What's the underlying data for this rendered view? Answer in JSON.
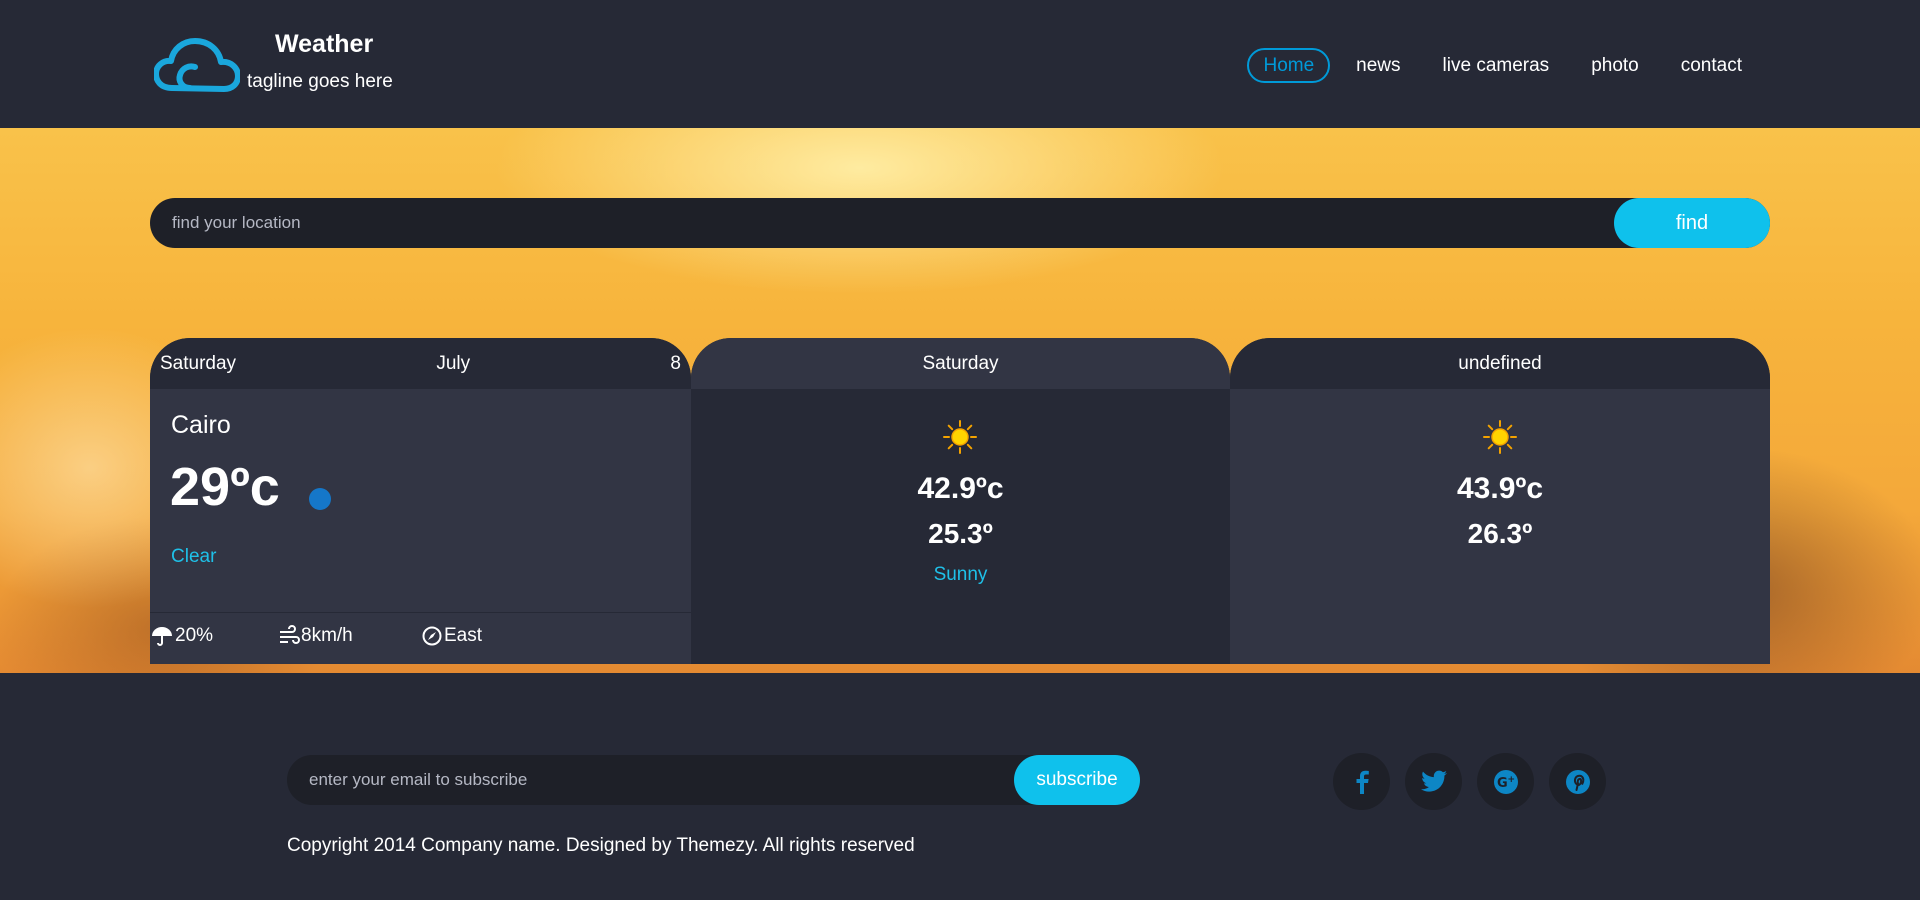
{
  "brand": {
    "title": "Weather",
    "tagline": "tagline goes here"
  },
  "nav": {
    "items": [
      {
        "label": "Home",
        "active": true
      },
      {
        "label": "news",
        "active": false
      },
      {
        "label": "live cameras",
        "active": false
      },
      {
        "label": "photo",
        "active": false
      },
      {
        "label": "contact",
        "active": false
      }
    ]
  },
  "search": {
    "placeholder": "find your location",
    "button_label": "find"
  },
  "today": {
    "day": "Saturday",
    "month": "July",
    "date": "8",
    "city": "Cairo",
    "temperature": "29ºc",
    "condition": "Clear",
    "condition_icon": "moon-icon",
    "stats": {
      "rain": "20%",
      "wind": "8km/h",
      "direction": "East"
    }
  },
  "forecast": [
    {
      "day": "Saturday",
      "max": "42.9ºc",
      "min": "25.3º",
      "condition": "Sunny",
      "icon": "sun-icon"
    },
    {
      "day": "undefined",
      "max": "43.9ºc",
      "min": "26.3º",
      "condition": "",
      "icon": "sun-icon"
    }
  ],
  "footer": {
    "subscribe_placeholder": "enter your email to subscribe",
    "subscribe_button": "subscribe",
    "copyright": "Copyright 2014 Company name. Designed by Themezy. All rights reserved",
    "socials": [
      "facebook-icon",
      "twitter-icon",
      "google-plus-icon",
      "pinterest-icon"
    ]
  },
  "colors": {
    "accent": "#0fc1ec",
    "nav_active": "#009ad8",
    "background": "#262936",
    "card": "#323544"
  }
}
